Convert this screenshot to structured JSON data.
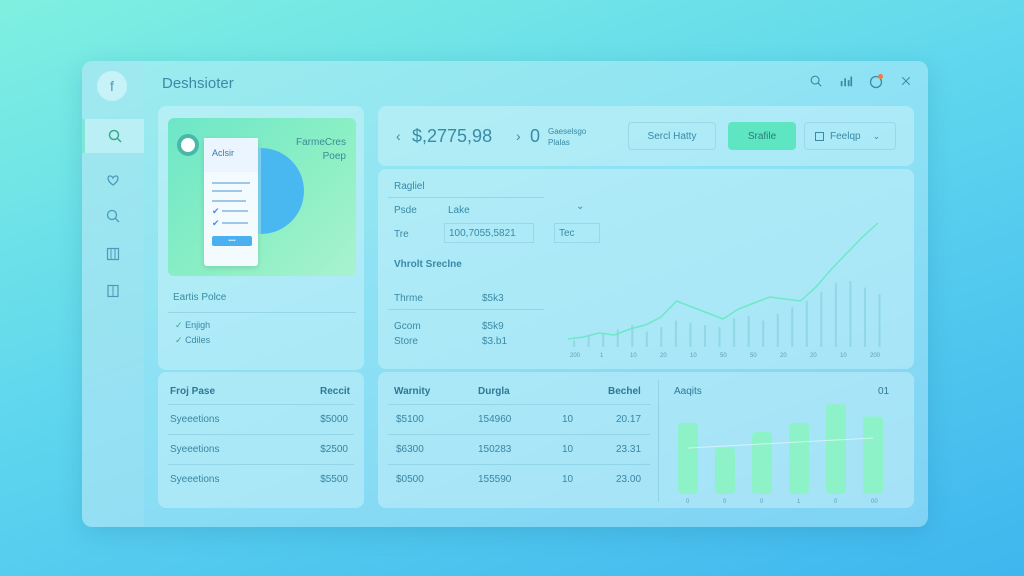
{
  "app": {
    "title": "Deshsioter"
  },
  "sidebar": {
    "logo_glyph": "f",
    "items": [
      {
        "name": "search-doc",
        "icon": "search-icon"
      },
      {
        "name": "heart",
        "icon": "heart-icon"
      },
      {
        "name": "search",
        "icon": "search-icon"
      },
      {
        "name": "columns",
        "icon": "columns-icon"
      },
      {
        "name": "book",
        "icon": "book-icon"
      }
    ]
  },
  "hero": {
    "card_label": "Aclsir",
    "title_line1": "FarmeCres",
    "title_line2": "Poep",
    "button_label": "••••"
  },
  "summary": {
    "title": "Eartis Polce",
    "checks": [
      "Enjigh",
      "Cdiles"
    ]
  },
  "stats": {
    "amount": "$,2775,98",
    "count": "0",
    "count_label_line1": "Gaeselsgo",
    "count_label_line2": "Plalas",
    "search_button": "Sercl Hatty",
    "primary_button": "Srafile",
    "dropdown_label": "Feelqp"
  },
  "filters": {
    "title": "Ragliel",
    "rows": [
      {
        "label": "Psde",
        "value": "Lake"
      },
      {
        "label": "Tre",
        "value": "100,7055,5821",
        "extra": "Tec"
      }
    ],
    "section_title": "Vhrolt Sreclne",
    "metrics": [
      {
        "label": "Thrme",
        "value": "$5k3"
      },
      {
        "label": "Gcom",
        "value": "$5k9"
      },
      {
        "label": "Store",
        "value": "$3.b1"
      }
    ]
  },
  "line_chart": {
    "points": [
      8,
      10,
      14,
      12,
      18,
      22,
      30,
      46,
      40,
      34,
      28,
      38,
      44,
      50,
      48,
      46,
      60,
      78,
      94,
      110,
      124
    ],
    "bars": [
      6,
      10,
      12,
      16,
      20,
      14,
      18,
      24,
      22,
      20,
      18,
      26,
      28,
      24,
      30,
      36,
      42,
      50,
      58,
      60,
      54,
      48
    ],
    "tick_labels": [
      "200",
      "1",
      "10",
      "20",
      "10",
      "50",
      "50",
      "20",
      "20",
      "10",
      "200"
    ]
  },
  "table_left": {
    "headers": [
      "Froj Pase",
      "Reccit"
    ],
    "rows": [
      [
        "Syeeetions",
        "$5000"
      ],
      [
        "Syeeetions",
        "$2500"
      ],
      [
        "Syeeetions",
        "$5500"
      ]
    ]
  },
  "table_mid": {
    "headers": [
      "Warnity",
      "Durgla",
      "",
      "Bechel"
    ],
    "rows": [
      [
        "$5100",
        "154960",
        "10",
        "20.17"
      ],
      [
        "$6300",
        "150283",
        "10",
        "23.31"
      ],
      [
        "$0500",
        "155590",
        "10",
        "23.00"
      ]
    ]
  },
  "bar_chart": {
    "title": "Aaqits",
    "badge": "01",
    "values": [
      46,
      30,
      40,
      46,
      58,
      50
    ],
    "labels": [
      "0",
      "0",
      "0",
      "1",
      "0",
      "00"
    ]
  },
  "colors": {
    "accent": "#5ee6c2",
    "brand": "#3a8aa6"
  }
}
